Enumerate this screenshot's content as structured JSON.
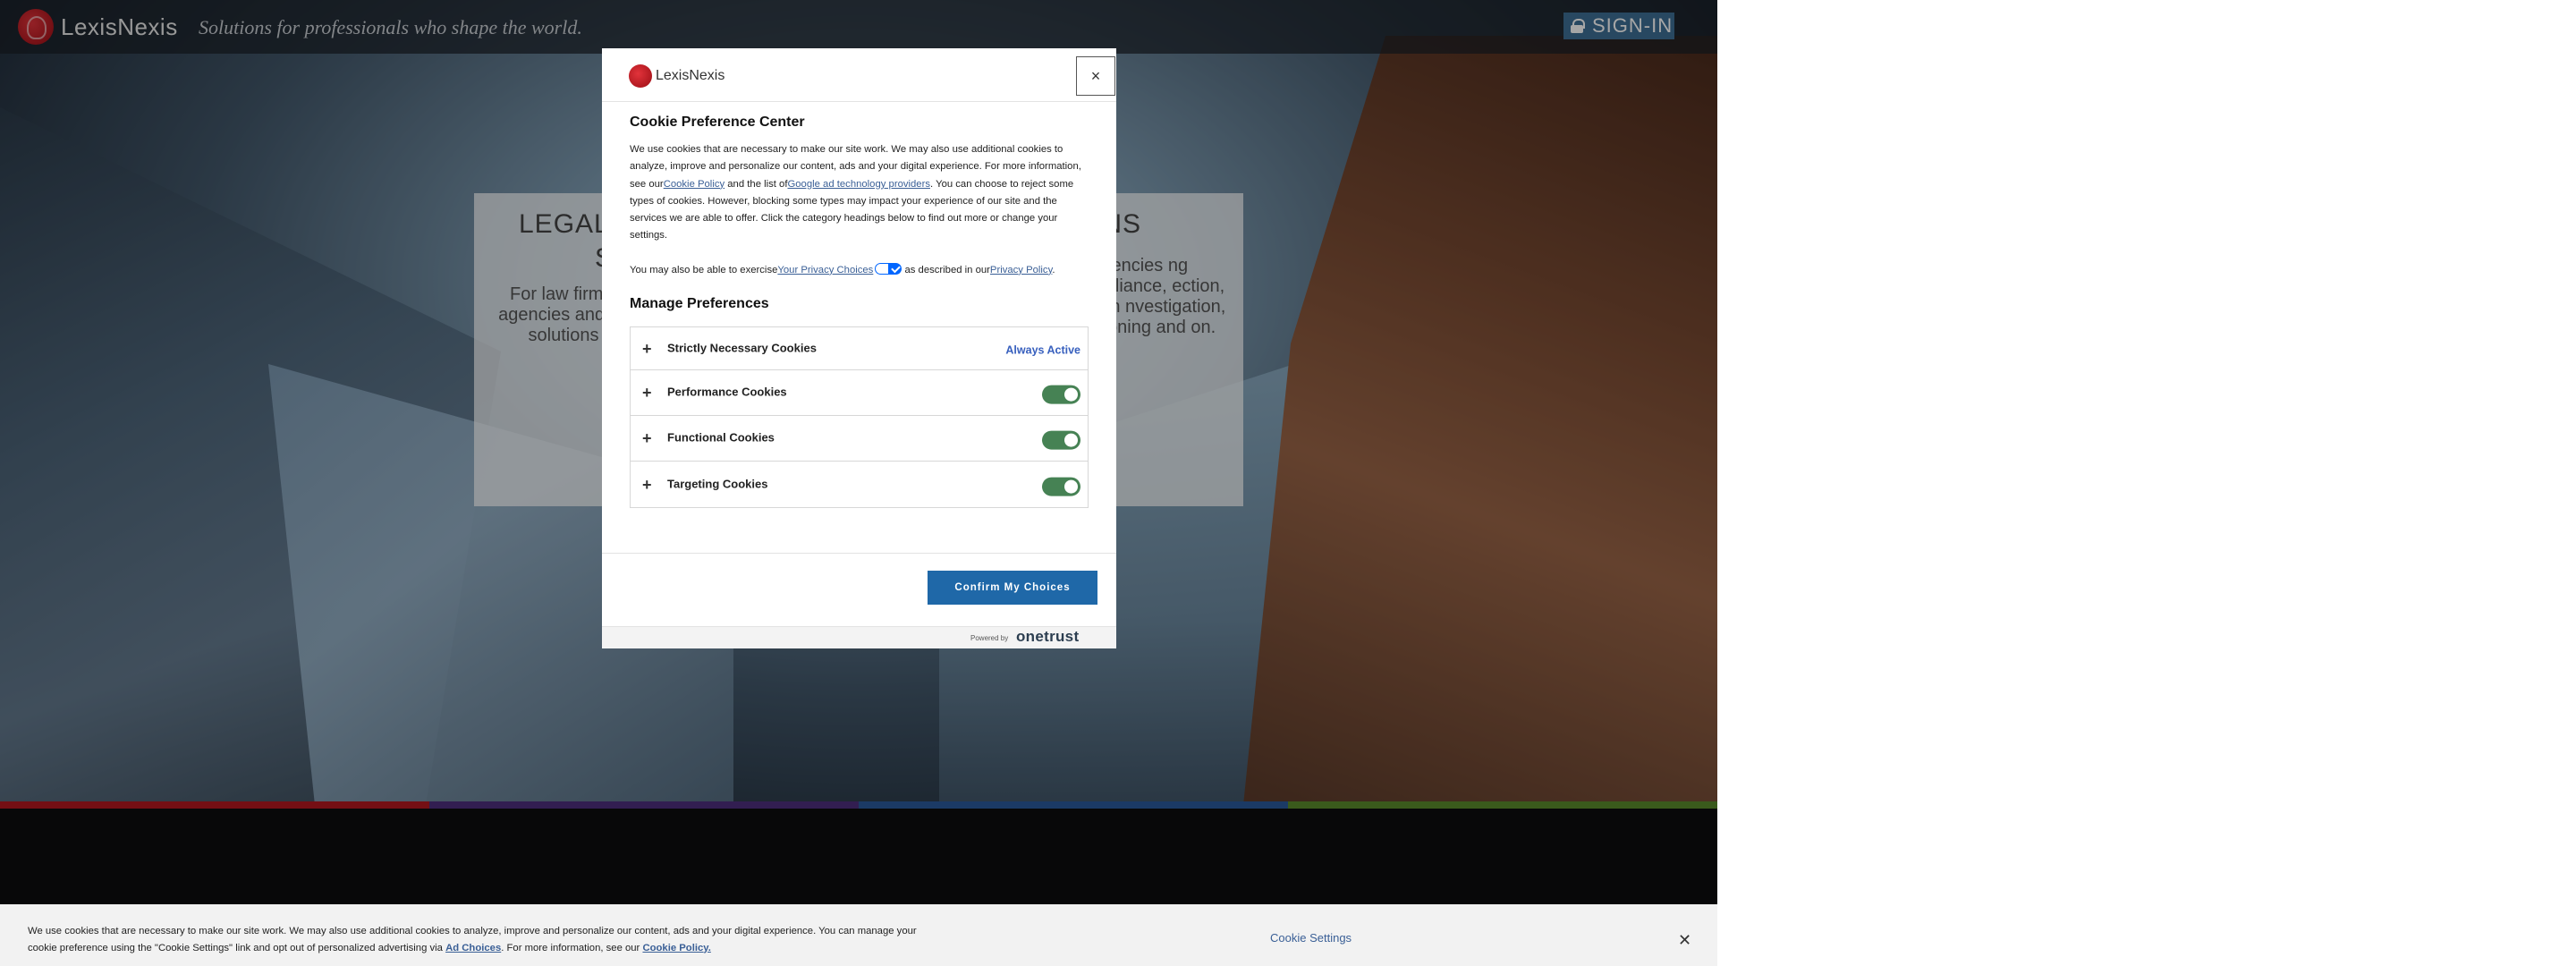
{
  "header": {
    "logo_text": "LexisNexis",
    "tagline": "Solutions for professionals who shape the world.",
    "signin_label": "SIGN-IN"
  },
  "panel": {
    "title_left_1": "LEGAL",
    "title_left_2": "S",
    "title_right": "ONS",
    "left_text": "For law firms, agencies and ac solutions",
    "right_text": "nt agencies ng compliance, ection, health nvestigation, ecisioning and on."
  },
  "stripe_colors": [
    "#b3181f",
    "#4d2f7d",
    "#2a5a9c",
    "#5a8a2c"
  ],
  "modal": {
    "logo_text": "LexisNexis",
    "close_label": "×",
    "title": "Cookie Preference Center",
    "desc_1": "We use cookies that are necessary to make our site work. We may also use additional cookies to analyze, improve and personalize our content, ads and your digital experience. For more information, see our",
    "cookie_policy_link": "Cookie Policy",
    "desc_2": " and the list of",
    "google_link": "Google ad technology providers",
    "desc_3": ". You can choose to reject some types of cookies. However, blocking some types may impact your experience of our site and the services we are able to offer. Click the category headings below to find out more or change your settings.",
    "privacy_1": "You may also be able to exercise",
    "your_privacy_link": "Your Privacy Choices",
    "privacy_2": " as described in our",
    "privacy_policy_link": "Privacy Policy",
    "privacy_3": ".",
    "manage_title": "Manage Preferences",
    "categories": [
      {
        "label": "Strictly Necessary Cookies",
        "status": "Always Active"
      },
      {
        "label": "Performance Cookies",
        "toggle": true
      },
      {
        "label": "Functional Cookies",
        "toggle": true
      },
      {
        "label": "Targeting Cookies",
        "toggle": true
      }
    ],
    "plus": "+",
    "confirm_label": "Confirm My Choices",
    "powered_by": "Powered by",
    "onetrust": "onetrust"
  },
  "banner": {
    "text_1": "We use cookies that are necessary to make our site work. We may also use additional cookies to analyze, improve and personalize our content, ads and your digital experience. You can manage your cookie preference using the \"Cookie Settings\" link and opt out of personalized advertising via ",
    "ad_choices_link": "Ad Choices",
    "text_2": ". For more information, see our ",
    "cookie_policy_link": "Cookie Policy.",
    "settings_label": "Cookie Settings",
    "close_label": "✕"
  }
}
